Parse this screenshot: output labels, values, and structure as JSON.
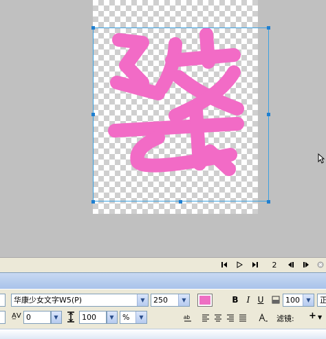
{
  "timeline": {
    "frame_number": "2"
  },
  "properties": {
    "font_family": "华康少女文字W5(P)",
    "font_size": "250",
    "fill_color": "#ee6fc3",
    "kerning_value": "0",
    "leading_value": "100",
    "leading_unit": "%",
    "opacity_value": "100",
    "bold_label": "B",
    "italic_label": "I",
    "underline_label": "U",
    "filters_label": "滤镜:",
    "normal_label": "正",
    "add_filter_label": "+"
  },
  "canvas": {
    "text_color": "#f26bc6"
  }
}
